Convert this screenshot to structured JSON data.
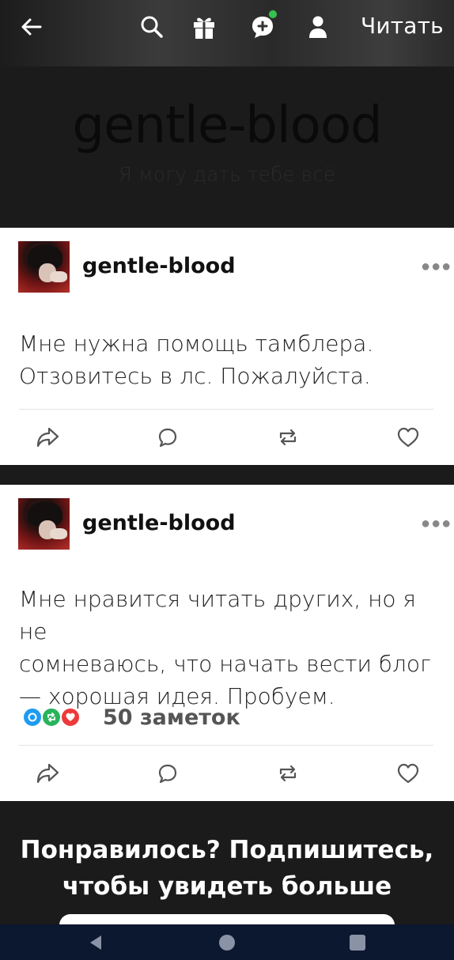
{
  "topbar": {
    "read_label": "Читать",
    "icons": [
      "arrow-left-icon",
      "search-icon",
      "gift-icon",
      "chat-plus-icon",
      "user-icon"
    ],
    "notification_color": "#33c24d"
  },
  "header": {
    "blog_title": "gentle-blood",
    "blog_subtitle": "Я могу дать тебе всё"
  },
  "posts": [
    {
      "author": "gentle-blood",
      "text_lines": [
        "Мне нужна помощь тамблера.",
        "Отзовитесь в лс. Пожалуйста."
      ],
      "actions": [
        "share-icon",
        "reply-icon",
        "reblog-icon",
        "like-icon"
      ]
    },
    {
      "author": "gentle-blood",
      "text_lines": [
        "Мне нравится читать других, но я не",
        "сомневаюсь, что начать вести блог",
        "— хорошая идея. Пробуем."
      ],
      "notes": "50 заметок",
      "actions": [
        "share-icon",
        "reply-icon",
        "reblog-icon",
        "like-icon"
      ]
    }
  ],
  "cta": {
    "line1": "Понравилось? Подпишитесь,",
    "line2": "чтобы увидеть больше"
  },
  "colors": {
    "background": "#1b1b1b",
    "navbar": "#0c1730",
    "notes_blue": "#1e9bf0",
    "notes_green": "#27b45b",
    "notes_red": "#ee3a3a"
  }
}
